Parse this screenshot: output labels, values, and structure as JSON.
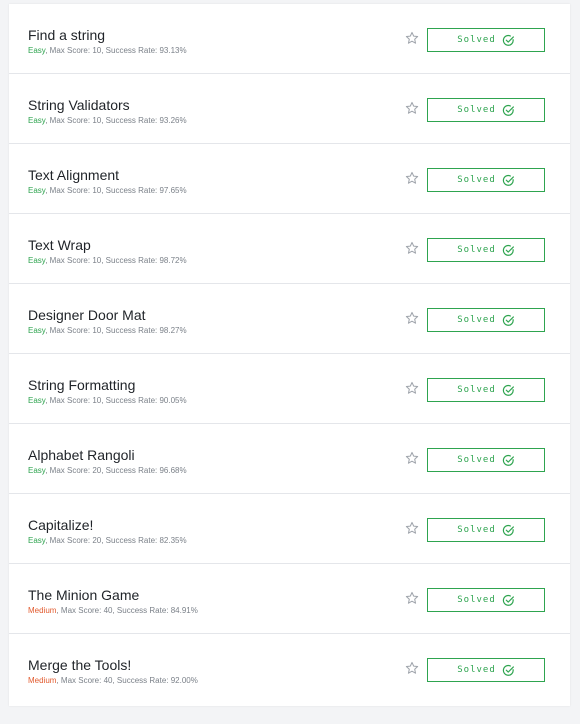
{
  "challenges": [
    {
      "title": "Find a string",
      "difficulty": "Easy",
      "rest": ", Max Score: 10, Success Rate: 93.13%",
      "status": "Solved"
    },
    {
      "title": "String Validators",
      "difficulty": "Easy",
      "rest": ", Max Score: 10, Success Rate: 93.26%",
      "status": "Solved"
    },
    {
      "title": "Text Alignment",
      "difficulty": "Easy",
      "rest": ", Max Score: 10, Success Rate: 97.65%",
      "status": "Solved"
    },
    {
      "title": "Text Wrap",
      "difficulty": "Easy",
      "rest": ", Max Score: 10, Success Rate: 98.72%",
      "status": "Solved"
    },
    {
      "title": "Designer Door Mat",
      "difficulty": "Easy",
      "rest": ", Max Score: 10, Success Rate: 98.27%",
      "status": "Solved"
    },
    {
      "title": "String Formatting",
      "difficulty": "Easy",
      "rest": ", Max Score: 10, Success Rate: 90.05%",
      "status": "Solved"
    },
    {
      "title": "Alphabet Rangoli",
      "difficulty": "Easy",
      "rest": ", Max Score: 20, Success Rate: 96.68%",
      "status": "Solved"
    },
    {
      "title": "Capitalize!",
      "difficulty": "Easy",
      "rest": ", Max Score: 20, Success Rate: 82.35%",
      "status": "Solved"
    },
    {
      "title": "The Minion Game",
      "difficulty": "Medium",
      "rest": ", Max Score: 40, Success Rate: 84.91%",
      "status": "Solved"
    },
    {
      "title": "Merge the Tools!",
      "difficulty": "Medium",
      "rest": ", Max Score: 40, Success Rate: 92.00%",
      "status": "Solved"
    }
  ],
  "colors": {
    "easy": "#2ea44f",
    "medium": "#e25b2f",
    "solved": "#2ea44f"
  },
  "icons": {
    "bookmark": "star-icon",
    "status": "check-circle-icon"
  }
}
